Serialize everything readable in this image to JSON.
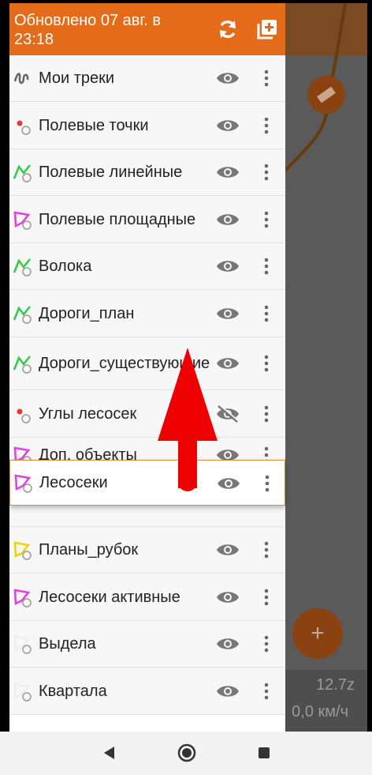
{
  "header": {
    "title": "Обновлено 07 авг. в 23:18",
    "refresh_icon": "refresh-icon",
    "add_icon": "add-layer-icon"
  },
  "layers": [
    {
      "label": "Мои треки",
      "icon": "track-icon",
      "visible": true
    },
    {
      "label": "Полевые точки",
      "icon": "point-layer-icon",
      "visible": true
    },
    {
      "label": "Полевые линейные",
      "icon": "line-layer-icon",
      "visible": true
    },
    {
      "label": "Полевые площадные",
      "icon": "polygon-layer-icon",
      "visible": true
    },
    {
      "label": "Волока",
      "icon": "line-layer-icon",
      "visible": true
    },
    {
      "label": "Дороги_план",
      "icon": "line-layer-icon",
      "visible": true
    },
    {
      "label": "Дороги_существующие",
      "icon": "line-layer-icon",
      "visible": true
    },
    {
      "label": "Углы лесосек",
      "icon": "point-layer-icon",
      "visible": false
    },
    {
      "label": "Доп. объекты",
      "icon": "polygon-layer-icon",
      "visible": true
    },
    {
      "label": "Лесосеки",
      "icon": "polygon-layer-icon",
      "visible": true
    },
    {
      "label": "Планы_рубок",
      "icon": "polygon-layer-icon",
      "visible": true
    },
    {
      "label": "Лесосеки активные",
      "icon": "polygon-layer-icon",
      "visible": true
    },
    {
      "label": "Выдела",
      "icon": "polygon-layer-icon",
      "visible": true
    },
    {
      "label": "Квартала",
      "icon": "polygon-layer-icon",
      "visible": true
    }
  ],
  "dragged": {
    "label": "Лесосеки"
  },
  "map": {
    "zoom": "12.7z",
    "speed": "0,0 км/ч"
  },
  "colors": {
    "accent": "#e36b19",
    "drag_border": "#e08a3a",
    "arrow": "#ee0000"
  }
}
